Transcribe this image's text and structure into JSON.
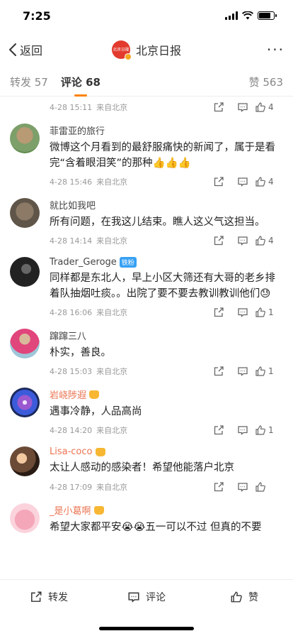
{
  "status": {
    "time": "7:25"
  },
  "nav": {
    "back_label": "返回",
    "title": "北京日报",
    "avatar_text": "北京日报",
    "more_label": "···"
  },
  "tabs": {
    "repost": "转发 57",
    "comments": "评论 68",
    "likes": "赞 563"
  },
  "first_meta": {
    "date": "4-28 15:11",
    "source": "来自北京",
    "likes": "4"
  },
  "comments": [
    {
      "name": "菲雷亚的旅行",
      "text": "微博这个月看到的最舒服痛快的新闻了，属于是看完“含着眼泪笑”的那种👍👍👍",
      "date": "4-28 15:46",
      "source": "来自北京",
      "likes": "4"
    },
    {
      "name": "就比如我吧",
      "text": "所有问题，在我这儿结束。瞧人这义气这担当。",
      "date": "4-28 14:14",
      "source": "来自北京",
      "likes": "4"
    },
    {
      "name": "Trader_Geroge",
      "badge": "铁粉",
      "text": "同样都是东北人，早上小区大筛还有大哥的老乡排着队抽烟吐痰。。出院了要不要去教训教训他们😓",
      "date": "4-28 16:06",
      "source": "来自北京",
      "likes": "1"
    },
    {
      "name": "蹿蹿三八",
      "text": "朴实，善良。",
      "date": "4-28 15:03",
      "source": "来自北京",
      "likes": "1"
    },
    {
      "name": "岩峣陟遐",
      "text": "遇事冷静，人品高尚",
      "date": "4-28 14:20",
      "source": "来自北京",
      "likes": "1"
    },
    {
      "name": "Lisa-coco",
      "text": "太让人感动的感染者！希望他能落户北京",
      "date": "4-28 17:09",
      "source": "来自北京",
      "likes": ""
    },
    {
      "name": "_是小葛啊",
      "text": "希望大家都平安😭😭五一可以不过 但真的不要",
      "date": "",
      "source": "",
      "likes": ""
    }
  ],
  "bottom": {
    "repost": "转发",
    "comment": "评论",
    "like": "赞"
  },
  "colors": {
    "accent": "#ff8200",
    "vip_name": "#eb7350",
    "badge": "#38a1f3"
  }
}
